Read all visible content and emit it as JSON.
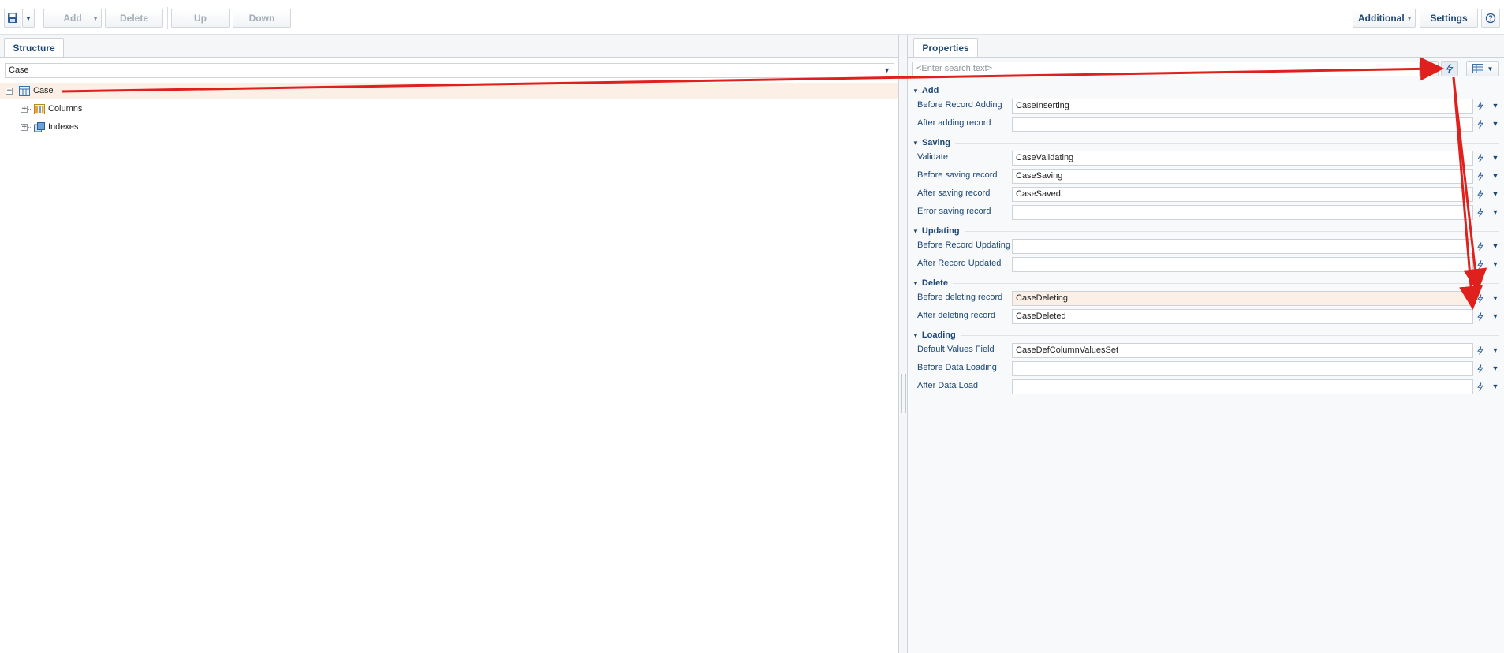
{
  "toolbar": {
    "save_icon": "floppy-disk-icon",
    "add_label": "Add",
    "delete_label": "Delete",
    "up_label": "Up",
    "down_label": "Down",
    "additional_label": "Additional",
    "settings_label": "Settings",
    "help_icon": "help-icon"
  },
  "structure": {
    "tab_label": "Structure",
    "object_select_value": "Case",
    "tree": {
      "root": {
        "label": "Case",
        "icon": "table-icon"
      },
      "children": [
        {
          "label": "Columns",
          "icon": "columns-icon"
        },
        {
          "label": "Indexes",
          "icon": "indexes-icon"
        }
      ]
    }
  },
  "properties": {
    "tab_label": "Properties",
    "search_placeholder": "<Enter search text>",
    "groups": [
      {
        "title": "Add",
        "rows": [
          {
            "label": "Before Record Adding",
            "value": "CaseInserting"
          },
          {
            "label": "After adding record",
            "value": ""
          }
        ]
      },
      {
        "title": "Saving",
        "rows": [
          {
            "label": "Validate",
            "value": "CaseValidating"
          },
          {
            "label": "Before saving record",
            "value": "CaseSaving"
          },
          {
            "label": "After saving record",
            "value": "CaseSaved"
          },
          {
            "label": "Error saving record",
            "value": ""
          }
        ]
      },
      {
        "title": "Updating",
        "rows": [
          {
            "label": "Before Record Updating",
            "value": ""
          },
          {
            "label": "After Record Updated",
            "value": ""
          }
        ]
      },
      {
        "title": "Delete",
        "rows": [
          {
            "label": "Before deleting record",
            "value": "CaseDeleting"
          },
          {
            "label": "After deleting record",
            "value": "CaseDeleted"
          }
        ]
      },
      {
        "title": "Loading",
        "rows": [
          {
            "label": "Default Values Field",
            "value": "CaseDefColumnValuesSet"
          },
          {
            "label": "Before Data Loading",
            "value": ""
          },
          {
            "label": "After Data Load",
            "value": ""
          }
        ]
      }
    ]
  },
  "colors": {
    "accent": "#1d4775",
    "annotation": "#e0201c",
    "selection": "#fbefe6"
  }
}
